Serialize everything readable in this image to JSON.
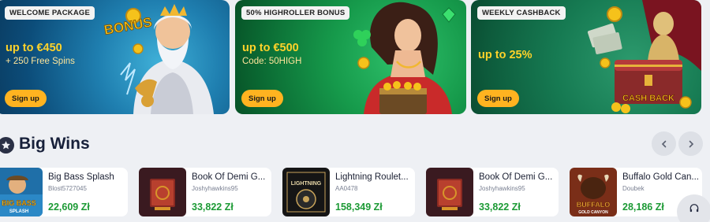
{
  "promos": [
    {
      "tag": "WELCOME PACKAGE",
      "headline": "up to €450",
      "sub": "+ 250 Free Spins",
      "button": "Sign up",
      "art_text": "BONUS",
      "character": "zeus-character"
    },
    {
      "tag": "50% HIGHROLLER BONUS",
      "headline": "up to €500",
      "sub": "Code: 50HIGH",
      "button": "Sign up",
      "character": "woman-with-chest-character"
    },
    {
      "tag": "WEEKLY CASHBACK",
      "headline": "up to 25%",
      "sub": "",
      "button": "Sign up",
      "art_text": "CASH BACK",
      "character": "cashback-chest-statue"
    }
  ],
  "big_wins": {
    "title": "Big Wins",
    "icon": "star-icon",
    "prev_icon": "chevron-left-icon",
    "next_icon": "chevron-right-icon"
  },
  "wins": [
    {
      "game": "Big Bass Splash",
      "player": "Blost5727045",
      "amount": "22,609 Zł",
      "thumb_text": "BIG BASS",
      "thumb_sub": "SPLASH",
      "colors": {
        "bg": "#1f6fa8",
        "accent": "#f5c21b"
      }
    },
    {
      "game": "Book Of Demi G...",
      "player": "Joshyhawkins95",
      "amount": "33,822 Zł",
      "thumb_text": "",
      "colors": {
        "bg": "#3a1a20",
        "accent": "#d8952a"
      }
    },
    {
      "game": "Lightning Roulet...",
      "player": "AA0478",
      "amount": "158,349 Zł",
      "thumb_text": "LIGHTNING",
      "colors": {
        "bg": "#151515",
        "accent": "#c9a45a"
      }
    },
    {
      "game": "Book Of Demi G...",
      "player": "Joshyhawkins95",
      "amount": "33,822 Zł",
      "thumb_text": "",
      "colors": {
        "bg": "#3a1a20",
        "accent": "#d8952a"
      }
    },
    {
      "game": "Buffalo Gold Can...",
      "player": "Doubek",
      "amount": "28,186 Zł",
      "thumb_text": "BUFFALO",
      "thumb_sub": "GOLD CANYON",
      "colors": {
        "bg": "#7a2e18",
        "accent": "#f0b33a"
      }
    }
  ],
  "support": {
    "icon": "headset-icon"
  },
  "theme": {
    "accent": "#ffb320",
    "headline": "#ffd32a",
    "win_amount": "#1c9a35",
    "title": "#17203a"
  }
}
